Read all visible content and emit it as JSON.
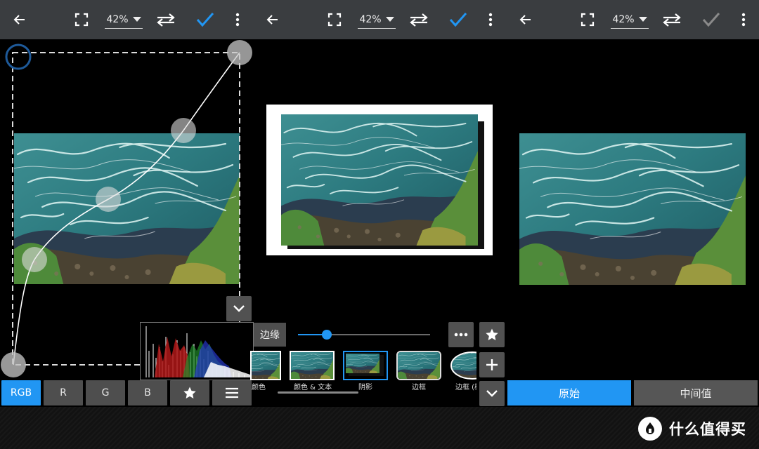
{
  "panels": [
    {
      "toolbar": {
        "zoom": "42%",
        "confirm_state": "enabled"
      }
    },
    {
      "toolbar": {
        "zoom": "42%",
        "confirm_state": "enabled"
      }
    },
    {
      "toolbar": {
        "zoom": "42%",
        "confirm_state": "disabled"
      }
    }
  ],
  "curves": {
    "channels": [
      "RGB",
      "R",
      "G",
      "B"
    ],
    "active_channel": "RGB",
    "favorite_icon": "star-icon",
    "menu_icon": "menu-icon",
    "collapse_icon": "chevron-down-icon"
  },
  "frames": {
    "setting_label": "边缘",
    "slider_value": 0.22,
    "thumbnails": [
      {
        "label": "颜色"
      },
      {
        "label": "颜色 & 文本"
      },
      {
        "label": "阴影",
        "selected": true
      },
      {
        "label": "边框"
      },
      {
        "label": "边框 (椭"
      }
    ],
    "side_icons": [
      "more-icon",
      "star-icon",
      "plus-icon",
      "chevron-down-icon"
    ]
  },
  "compare": {
    "original_label": "原始",
    "intermediate_label": "中间值",
    "active": "original"
  },
  "watermark": {
    "text": "什么值得买"
  },
  "colors": {
    "accent": "#2196f3",
    "toolbar": "#3a3d40",
    "button": "#4e4e4e",
    "disabled": "#8a8a8a"
  }
}
